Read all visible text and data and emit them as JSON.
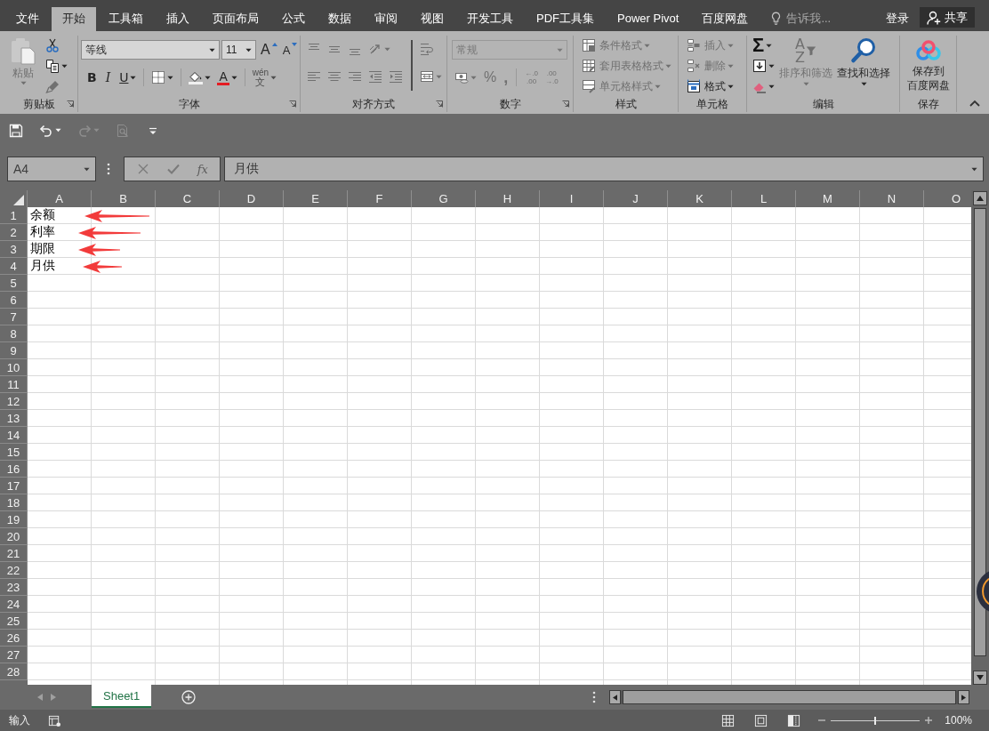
{
  "tabs": [
    {
      "label": "文件",
      "selected": false
    },
    {
      "label": "开始",
      "selected": true
    },
    {
      "label": "工具箱",
      "selected": false
    },
    {
      "label": "插入",
      "selected": false
    },
    {
      "label": "页面布局",
      "selected": false
    },
    {
      "label": "公式",
      "selected": false
    },
    {
      "label": "数据",
      "selected": false
    },
    {
      "label": "审阅",
      "selected": false
    },
    {
      "label": "视图",
      "selected": false
    },
    {
      "label": "开发工具",
      "selected": false
    },
    {
      "label": "PDF工具集",
      "selected": false
    },
    {
      "label": "Power Pivot",
      "selected": false
    },
    {
      "label": "百度网盘",
      "selected": false
    }
  ],
  "tell_me": {
    "placeholder": "告诉我..."
  },
  "account": {
    "sign_in": "登录",
    "share": "共享"
  },
  "ribbon": {
    "clipboard": {
      "label": "剪贴板",
      "paste": {
        "label": "粘贴",
        "disabled": true
      },
      "tools": [
        {
          "kind": "cut",
          "disabled": false
        },
        {
          "kind": "copy",
          "disabled": false
        },
        {
          "kind": "format-painter",
          "disabled": true
        }
      ]
    },
    "font": {
      "label": "字体",
      "name": "等线",
      "size": "11",
      "grow": "A",
      "shrink": "A",
      "buttons": [
        {
          "kind": "bold",
          "text": "B",
          "disabled": false
        },
        {
          "kind": "italic",
          "text": "I",
          "disabled": false
        },
        {
          "kind": "underline",
          "text": "U",
          "disabled": false
        },
        {
          "kind": "borders",
          "disabled": false
        },
        {
          "kind": "fill-color",
          "disabled": false
        },
        {
          "kind": "font-color",
          "text": "A",
          "disabled": false
        },
        {
          "kind": "phonetic",
          "text": "wén",
          "sub": "文",
          "disabled": true
        }
      ]
    },
    "alignment": {
      "label": "对齐方式",
      "rows": [
        [
          {
            "kind": "align-top",
            "disabled": true
          },
          {
            "kind": "align-middle",
            "disabled": true
          },
          {
            "kind": "align-bottom",
            "disabled": true
          },
          {
            "kind": "orientation",
            "disabled": true
          }
        ],
        [
          {
            "kind": "align-left",
            "disabled": true
          },
          {
            "kind": "align-center",
            "disabled": true
          },
          {
            "kind": "align-right",
            "disabled": true
          },
          {
            "kind": "indent-decrease",
            "disabled": true
          },
          {
            "kind": "indent-increase",
            "disabled": true
          }
        ]
      ],
      "side": [
        {
          "kind": "wrap",
          "disabled": true
        },
        {
          "kind": "merge",
          "disabled": true
        }
      ]
    },
    "number": {
      "label": "数字",
      "format": {
        "value": "常规",
        "disabled": true
      },
      "buttons": [
        {
          "kind": "currency",
          "disabled": true
        },
        {
          "kind": "percent",
          "text": "%",
          "disabled": true
        },
        {
          "kind": "comma",
          "text": ",",
          "disabled": true
        },
        {
          "kind": "decrease-decimal",
          "lines": [
            "←.0",
            ".00"
          ],
          "disabled": true
        },
        {
          "kind": "increase-decimal",
          "lines": [
            ".00",
            "→.0"
          ],
          "disabled": true
        }
      ]
    },
    "styles": {
      "label": "样式",
      "buttons": [
        {
          "kind": "conditional-format",
          "label": "条件格式",
          "disabled": true
        },
        {
          "kind": "table-format",
          "label": "套用表格格式",
          "disabled": true
        },
        {
          "kind": "cell-styles",
          "label": "单元格样式",
          "disabled": true
        }
      ]
    },
    "cells": {
      "label": "单元格",
      "buttons": [
        {
          "kind": "insert",
          "label": "插入",
          "disabled": true
        },
        {
          "kind": "delete",
          "label": "删除",
          "disabled": true
        },
        {
          "kind": "format",
          "label": "格式",
          "disabled": false
        }
      ]
    },
    "editing": {
      "label": "编辑",
      "buttons": [
        {
          "kind": "sum",
          "text": "Σ",
          "disabled": false
        },
        {
          "kind": "fill",
          "disabled": false
        },
        {
          "kind": "clear",
          "disabled": false
        }
      ],
      "sort": {
        "label": "排序和筛选",
        "letters": [
          "A",
          "Z"
        ],
        "disabled": true
      },
      "find": {
        "label": "查找和选择",
        "disabled": false
      }
    },
    "save": {
      "label": "保存",
      "button": {
        "lines": [
          "保存到",
          "百度网盘"
        ],
        "disabled": false
      }
    }
  },
  "quick_access": [
    {
      "kind": "save",
      "disabled": false
    },
    {
      "kind": "undo",
      "disabled": false
    },
    {
      "kind": "redo",
      "disabled": true
    },
    {
      "kind": "print-preview",
      "disabled": true
    },
    {
      "kind": "customize",
      "disabled": false
    }
  ],
  "formula_bar": {
    "name_box": "A4",
    "fx": "fx",
    "value": "月供"
  },
  "grid": {
    "columns": [
      "A",
      "B",
      "C",
      "D",
      "E",
      "F",
      "G",
      "H",
      "I",
      "J",
      "K",
      "L",
      "M",
      "N",
      "O"
    ],
    "rows": [
      {
        "label": "1",
        "cells": [
          "余额"
        ],
        "arrow": true
      },
      {
        "label": "2",
        "cells": [
          "利率"
        ],
        "arrow": true
      },
      {
        "label": "3",
        "cells": [
          "期限"
        ],
        "arrow": true
      },
      {
        "label": "4",
        "cells": [
          "月供"
        ],
        "arrow": true
      },
      {
        "label": "5",
        "arrow": false
      },
      {
        "label": "6",
        "arrow": false
      },
      {
        "label": "7",
        "arrow": false
      },
      {
        "label": "8",
        "arrow": false
      },
      {
        "label": "9",
        "arrow": false
      },
      {
        "label": "10",
        "arrow": false
      },
      {
        "label": "11",
        "arrow": false
      },
      {
        "label": "12",
        "arrow": false
      },
      {
        "label": "13",
        "arrow": false
      },
      {
        "label": "14",
        "arrow": false
      },
      {
        "label": "15",
        "arrow": false
      },
      {
        "label": "16",
        "arrow": false
      },
      {
        "label": "17",
        "arrow": false
      },
      {
        "label": "18",
        "arrow": false
      },
      {
        "label": "19",
        "arrow": false
      },
      {
        "label": "20",
        "arrow": false
      },
      {
        "label": "21",
        "arrow": false
      },
      {
        "label": "22",
        "arrow": false
      },
      {
        "label": "23",
        "arrow": false
      },
      {
        "label": "24",
        "arrow": false
      },
      {
        "label": "25",
        "arrow": false
      },
      {
        "label": "26",
        "arrow": false
      },
      {
        "label": "27",
        "arrow": false
      },
      {
        "label": "28",
        "arrow": false
      }
    ]
  },
  "sheets": [
    {
      "label": "Sheet1",
      "selected": true
    }
  ],
  "status": {
    "mode": "输入",
    "zoom": {
      "level": 0.5,
      "reading": "100%"
    }
  }
}
